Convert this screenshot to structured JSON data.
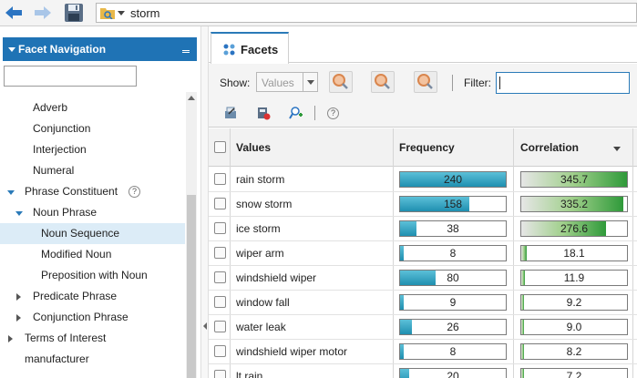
{
  "search": {
    "query": "storm"
  },
  "facet_nav": {
    "title": "Facet Navigation",
    "tree": [
      {
        "label": "Adverb",
        "level": 2,
        "expander": "none",
        "selected": false
      },
      {
        "label": "Conjunction",
        "level": 2,
        "expander": "none",
        "selected": false
      },
      {
        "label": "Interjection",
        "level": 2,
        "expander": "none",
        "selected": false
      },
      {
        "label": "Numeral",
        "level": 2,
        "expander": "none",
        "selected": false
      },
      {
        "label": "Phrase Constituent",
        "level": 1,
        "expander": "expanded",
        "selected": false,
        "help": true
      },
      {
        "label": "Noun Phrase",
        "level": 2,
        "expander": "expanded",
        "selected": false
      },
      {
        "label": "Noun Sequence",
        "level": 3,
        "expander": "none",
        "selected": true
      },
      {
        "label": "Modified Noun",
        "level": 3,
        "expander": "none",
        "selected": false
      },
      {
        "label": "Preposition with Noun",
        "level": 3,
        "expander": "none",
        "selected": false
      },
      {
        "label": "Predicate Phrase",
        "level": 2,
        "expander": "collapsed",
        "selected": false
      },
      {
        "label": "Conjunction Phrase",
        "level": 2,
        "expander": "collapsed",
        "selected": false
      },
      {
        "label": "Terms of Interest",
        "level": 1,
        "expander": "collapsed",
        "selected": false
      },
      {
        "label": "manufacturer",
        "level": 1,
        "expander": "none",
        "selected": false
      }
    ]
  },
  "facets_tab": {
    "label": "Facets"
  },
  "toolbar": {
    "show_label": "Show:",
    "show_value": "Values",
    "filter_label": "Filter:",
    "help_glyph": "?"
  },
  "table": {
    "headers": {
      "values": "Values",
      "frequency": "Frequency",
      "correlation": "Correlation"
    },
    "freq_max": 240,
    "corr_max": 345.7,
    "rows": [
      {
        "value": "rain storm",
        "frequency": 240,
        "frequency_label": "240",
        "correlation": 345.7,
        "correlation_label": "345.7"
      },
      {
        "value": "snow storm",
        "frequency": 158,
        "frequency_label": "158",
        "correlation": 335.2,
        "correlation_label": "335.2"
      },
      {
        "value": "ice storm",
        "frequency": 38,
        "frequency_label": "38",
        "correlation": 276.6,
        "correlation_label": "276.6"
      },
      {
        "value": "wiper arm",
        "frequency": 8,
        "frequency_label": "8",
        "correlation": 18.1,
        "correlation_label": "18.1"
      },
      {
        "value": "windshield wiper",
        "frequency": 80,
        "frequency_label": "80",
        "correlation": 11.9,
        "correlation_label": "11.9"
      },
      {
        "value": "window fall",
        "frequency": 9,
        "frequency_label": "9",
        "correlation": 9.2,
        "correlation_label": "9.2"
      },
      {
        "value": "water leak",
        "frequency": 26,
        "frequency_label": "26",
        "correlation": 9.0,
        "correlation_label": "9.0"
      },
      {
        "value": "windshield wiper motor",
        "frequency": 8,
        "frequency_label": "8",
        "correlation": 8.2,
        "correlation_label": "8.2"
      },
      {
        "value": "lt rain",
        "frequency": 20,
        "frequency_label": "20",
        "correlation": 7.2,
        "correlation_label": "7.2"
      }
    ]
  }
}
